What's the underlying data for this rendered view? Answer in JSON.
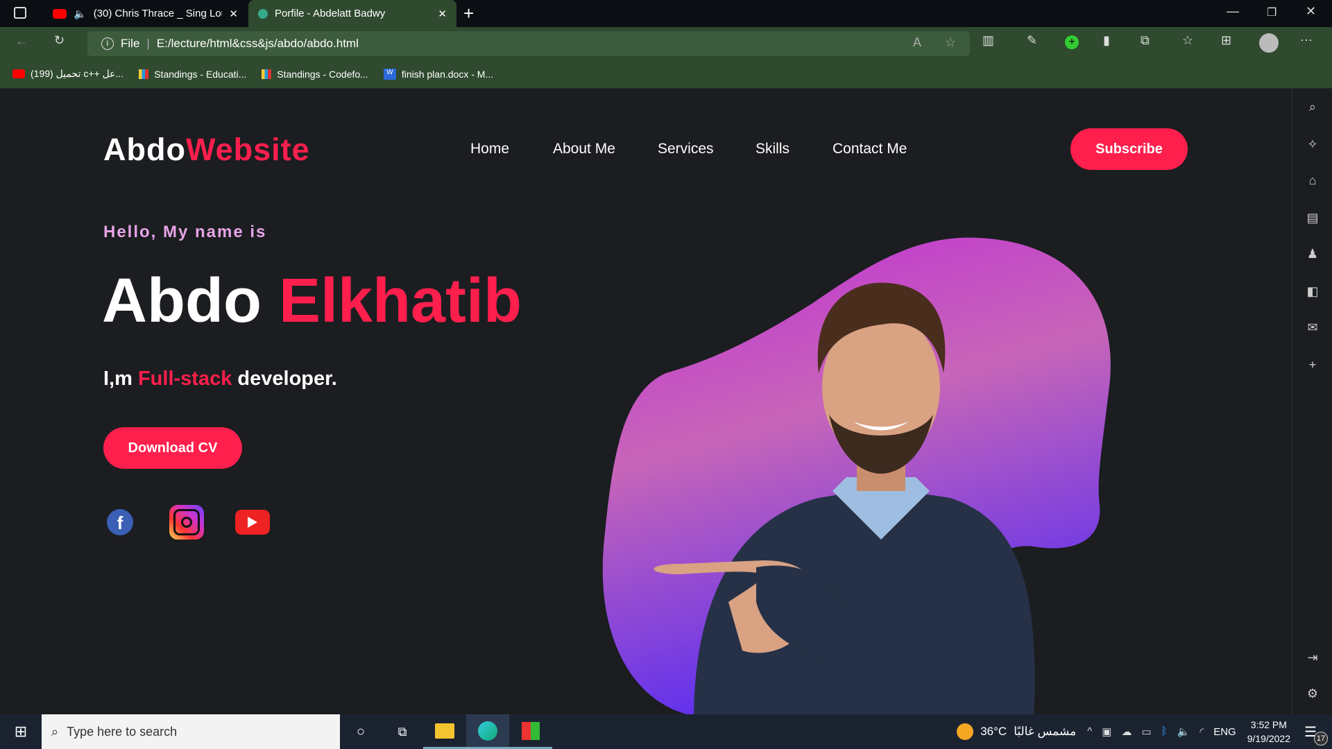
{
  "browser": {
    "tabs": [
      {
        "title": "(30) Chris Thrace _ Sing Loud",
        "icon": "youtube-icon"
      },
      {
        "title": "Porfile - Abdelatt Badwy",
        "icon": "globe-icon"
      }
    ],
    "address": {
      "scheme": "File",
      "url": "E:/lecture/html&css&js/abdo/abdo.html"
    },
    "bookmarks": [
      {
        "label": "(199) تحميل c++ عل...",
        "icon": "youtube-icon"
      },
      {
        "label": "Standings - Educati...",
        "icon": "chart-icon"
      },
      {
        "label": "Standings - Codefo...",
        "icon": "chart-icon"
      },
      {
        "label": "finish plan.docx - M...",
        "icon": "word-icon"
      }
    ]
  },
  "site": {
    "logo": {
      "part1": "Abdo",
      "part2": "Website"
    },
    "nav": [
      "Home",
      "About Me",
      "Services",
      "Skills",
      "Contact Me"
    ],
    "subscribe": "Subscribe",
    "hero": {
      "greeting": "Hello, My name is",
      "first": "Abdo",
      "last": "Elkhatib",
      "tag_pre": "I,m",
      "tag_hl": "Full-stack",
      "tag_post": "developer.",
      "cta": "Download CV"
    },
    "social": [
      "facebook",
      "instagram",
      "youtube"
    ],
    "accent": "#ff1f4d"
  },
  "taskbar": {
    "search_placeholder": "Type here to search",
    "weather": "36°C",
    "weather_desc": "مشمس غالبًا",
    "lang": "ENG",
    "time": "3:52 PM",
    "date": "9/19/2022",
    "notifications": "17"
  }
}
